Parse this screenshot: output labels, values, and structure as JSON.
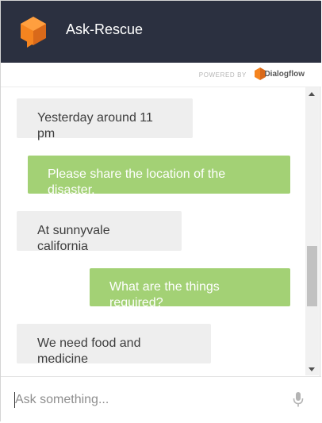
{
  "header": {
    "title": "Ask-Rescue",
    "logo_icon": "orange-cube-agent-icon",
    "background": "#2b3040"
  },
  "powered_by": {
    "label": "POWERED BY",
    "brand": "Dialogflow",
    "brand_icon": "dialogflow-logo-icon"
  },
  "messages": [
    {
      "sender": "agent",
      "text": "Yesterday around 11 pm"
    },
    {
      "sender": "user",
      "text": "Please share the location of the disaster."
    },
    {
      "sender": "agent",
      "text": "At sunnyvale california"
    },
    {
      "sender": "user",
      "text": "What are the things required?"
    },
    {
      "sender": "agent",
      "text": "We need food and medicine"
    }
  ],
  "input": {
    "placeholder": "Ask something...",
    "value": "",
    "mic_icon": "microphone-icon"
  },
  "colors": {
    "user_bubble": "#a3d175",
    "agent_bubble": "#eeeeee",
    "accent": "#f5841f"
  }
}
